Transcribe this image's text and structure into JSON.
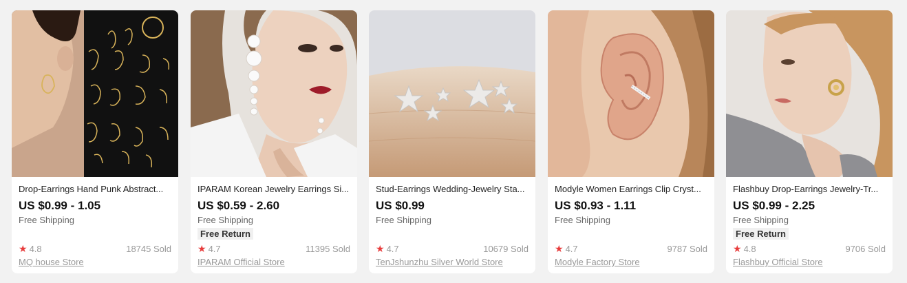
{
  "colors": {
    "page_bg": "#f2f2f2",
    "card_bg": "#ffffff",
    "star": "#e73b3b",
    "price": "#111111"
  },
  "products": [
    {
      "image_icon": "product-photo-face-line-earrings",
      "title": "Drop-Earrings Hand Punk Abstract...",
      "price": "US $0.99 - 1.05",
      "shipping": "Free Shipping",
      "badge": "",
      "rating": "4.8",
      "sold": "18745 Sold",
      "store": "MQ house Store"
    },
    {
      "image_icon": "product-photo-pearl-drop-earrings",
      "title": "IPARAM Korean Jewelry Earrings Si...",
      "price": "US $0.59 - 2.60",
      "shipping": "Free Shipping",
      "badge": "Free Return",
      "rating": "4.7",
      "sold": "11395 Sold",
      "store": "IPARAM Official Store"
    },
    {
      "image_icon": "product-photo-star-stud-earrings",
      "title": "Stud-Earrings Wedding-Jewelry Sta...",
      "price": "US $0.99",
      "shipping": "Free Shipping",
      "badge": "",
      "rating": "4.7",
      "sold": "10679 Sold",
      "store": "TenJshunzhu Silver World Store"
    },
    {
      "image_icon": "product-photo-ear-cuff",
      "title": "Modyle Women Earrings Clip Cryst...",
      "price": "US $0.93 - 1.11",
      "shipping": "Free Shipping",
      "badge": "",
      "rating": "4.7",
      "sold": "9787 Sold",
      "store": "Modyle Factory Store"
    },
    {
      "image_icon": "product-photo-gold-hoop-earrings",
      "title": "Flashbuy Drop-Earrings Jewelry-Tr...",
      "price": "US $0.99 - 2.25",
      "shipping": "Free Shipping",
      "badge": "Free Return",
      "rating": "4.8",
      "sold": "9706 Sold",
      "store": "Flashbuy Official Store"
    }
  ]
}
